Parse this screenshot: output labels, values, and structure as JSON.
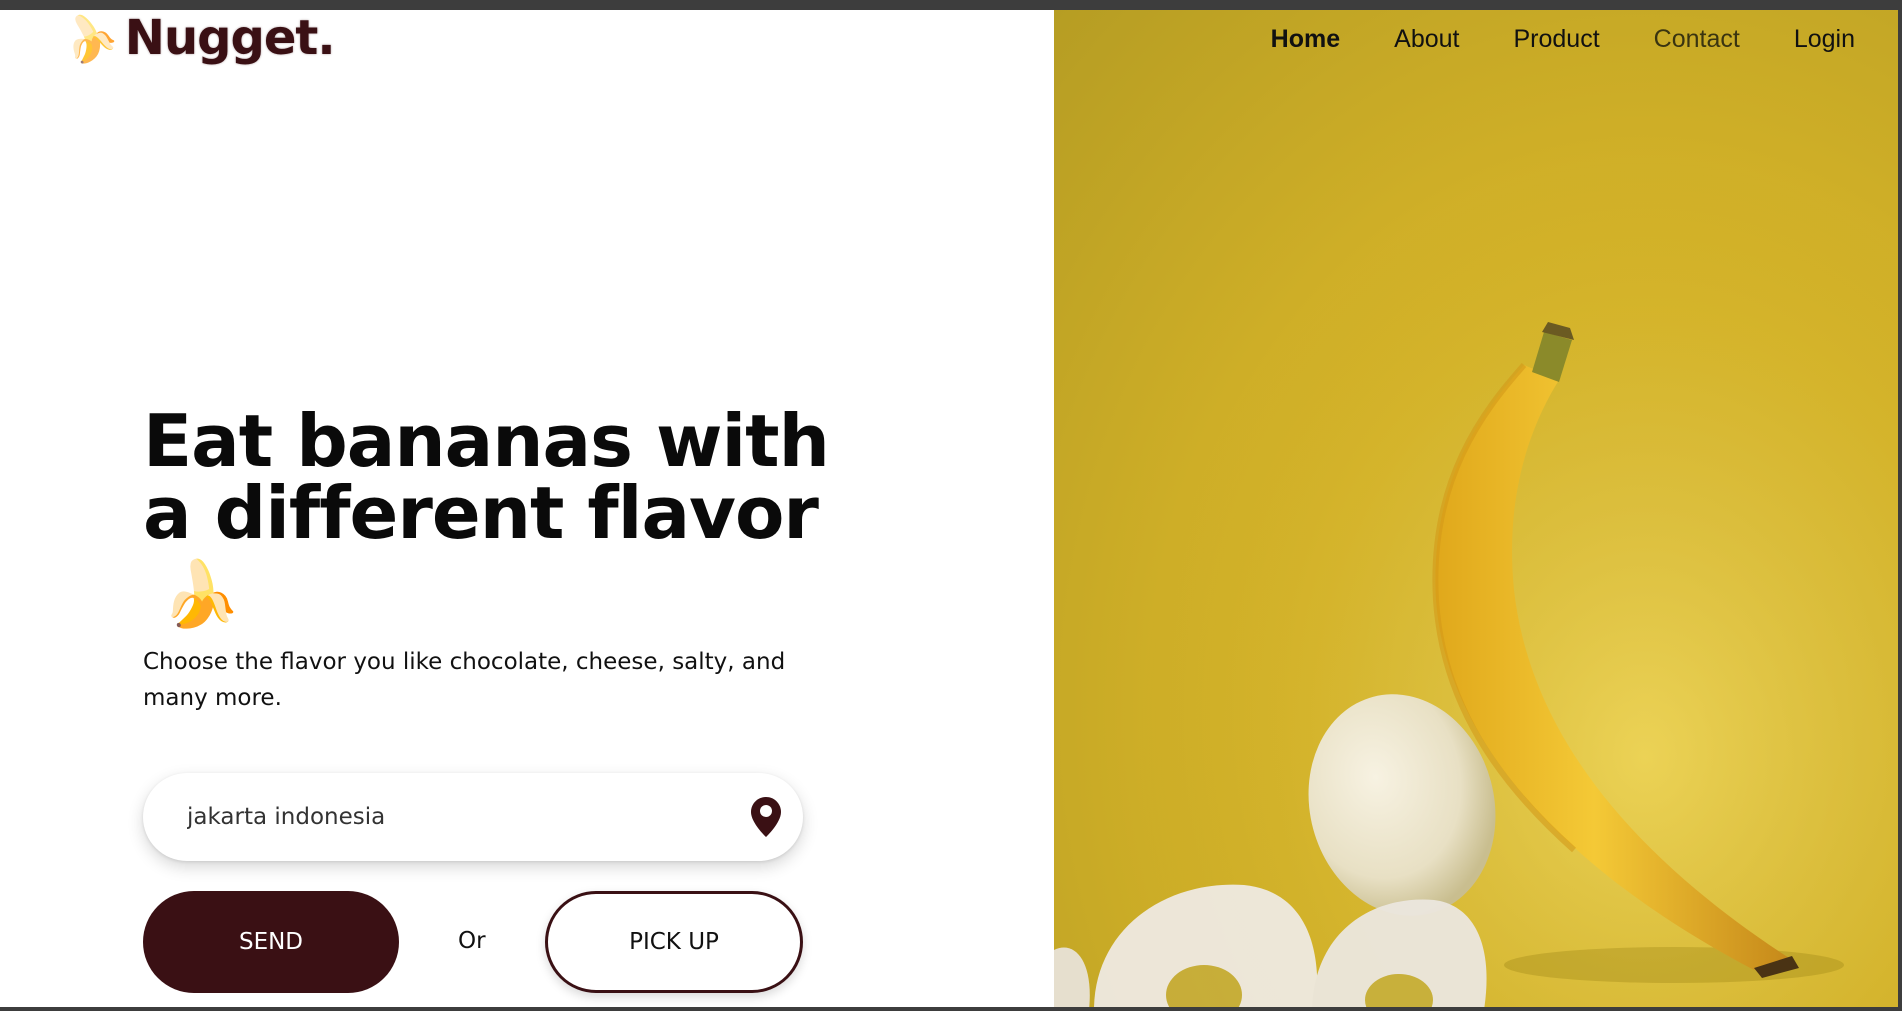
{
  "brand": {
    "name": "Nugget.",
    "icon": "banana-icon"
  },
  "nav": {
    "items": [
      {
        "label": "Home",
        "active": true
      },
      {
        "label": "About",
        "active": false
      },
      {
        "label": "Product",
        "active": false
      },
      {
        "label": "Contact",
        "active": false
      },
      {
        "label": "Login",
        "active": false
      }
    ]
  },
  "hero": {
    "title": "Eat bananas with a different flavor",
    "title_emoji": "🍌",
    "subtitle": "Choose the flavor you like chocolate, cheese, salty, and many more."
  },
  "location": {
    "value": "jakarta indonesia",
    "icon": "location-pin-icon"
  },
  "actions": {
    "send_label": "SEND",
    "or_label": "Or",
    "pickup_label": "PICK UP"
  },
  "colors": {
    "brand_dark": "#3a1014",
    "hero_yellow": "#d9b629"
  }
}
